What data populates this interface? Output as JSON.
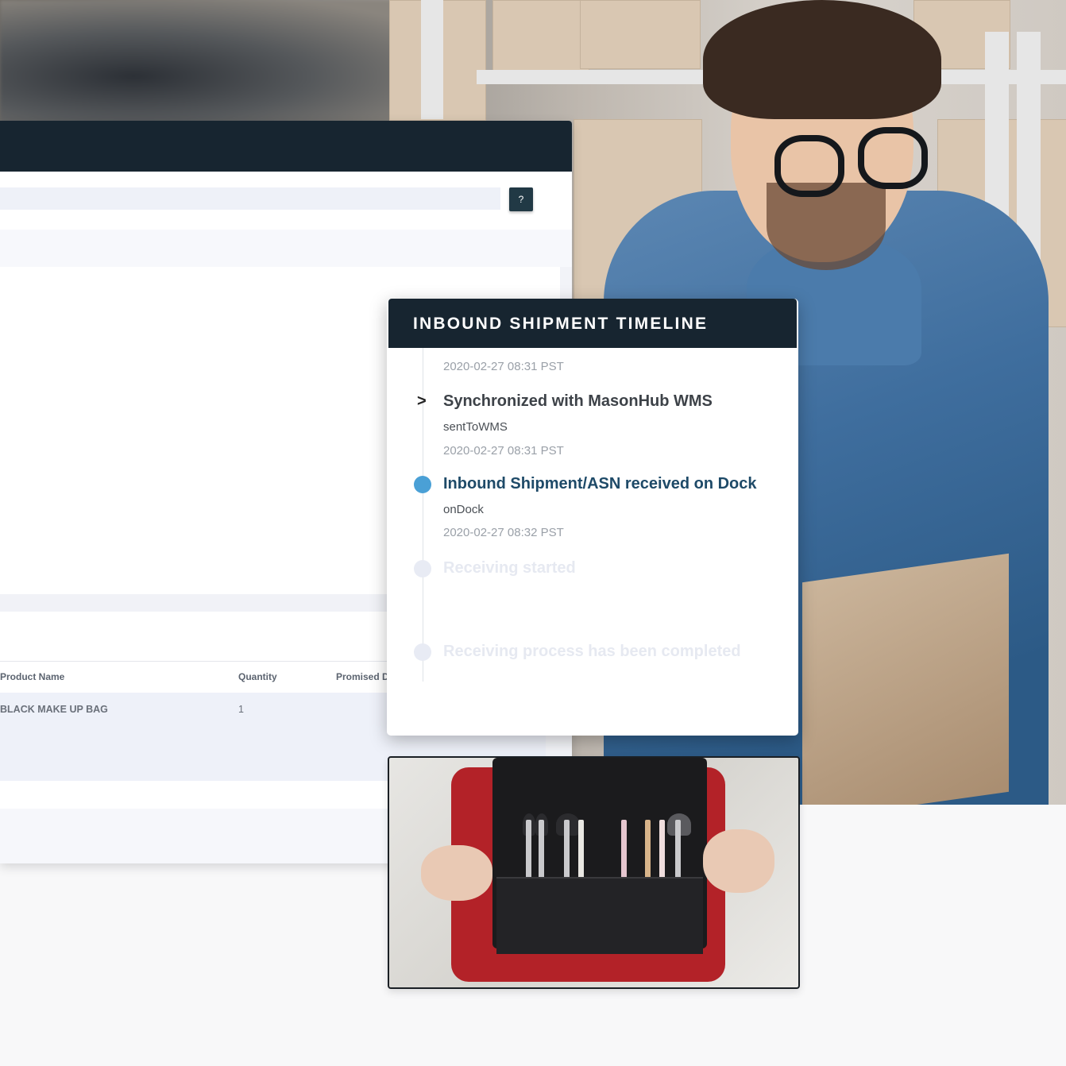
{
  "dashboard": {
    "help_label": "?",
    "table": {
      "headers": [
        "Product Name",
        "Quantity",
        "Promised D"
      ],
      "rows": [
        {
          "product_name": "BLACK MAKE UP BAG",
          "quantity": "1"
        }
      ]
    }
  },
  "timeline": {
    "title": "INBOUND SHIPMENT TIMELINE",
    "top_timestamp": "2020-02-27 08:31 PST",
    "events": [
      {
        "title": "Synchronized with MasonHub WMS",
        "code": "sentToWMS",
        "timestamp": "2020-02-27 08:31 PST",
        "state": "done"
      },
      {
        "title": "Inbound Shipment/ASN received on Dock",
        "code": "onDock",
        "timestamp": "2020-02-27 08:32 PST",
        "state": "current"
      },
      {
        "title": "Receiving started",
        "state": "pending"
      },
      {
        "title": "Receiving process has been completed",
        "state": "pending"
      }
    ],
    "colors": {
      "header": "#172530",
      "current_dot": "#4aa0d6",
      "current_text": "#1e4a68",
      "pending": "#e8ebf4"
    }
  },
  "images": {
    "background": "warehouse worker in denim shirt and glasses holding a cardboard box",
    "product": "open black make-up bag with red lining and brushes"
  }
}
